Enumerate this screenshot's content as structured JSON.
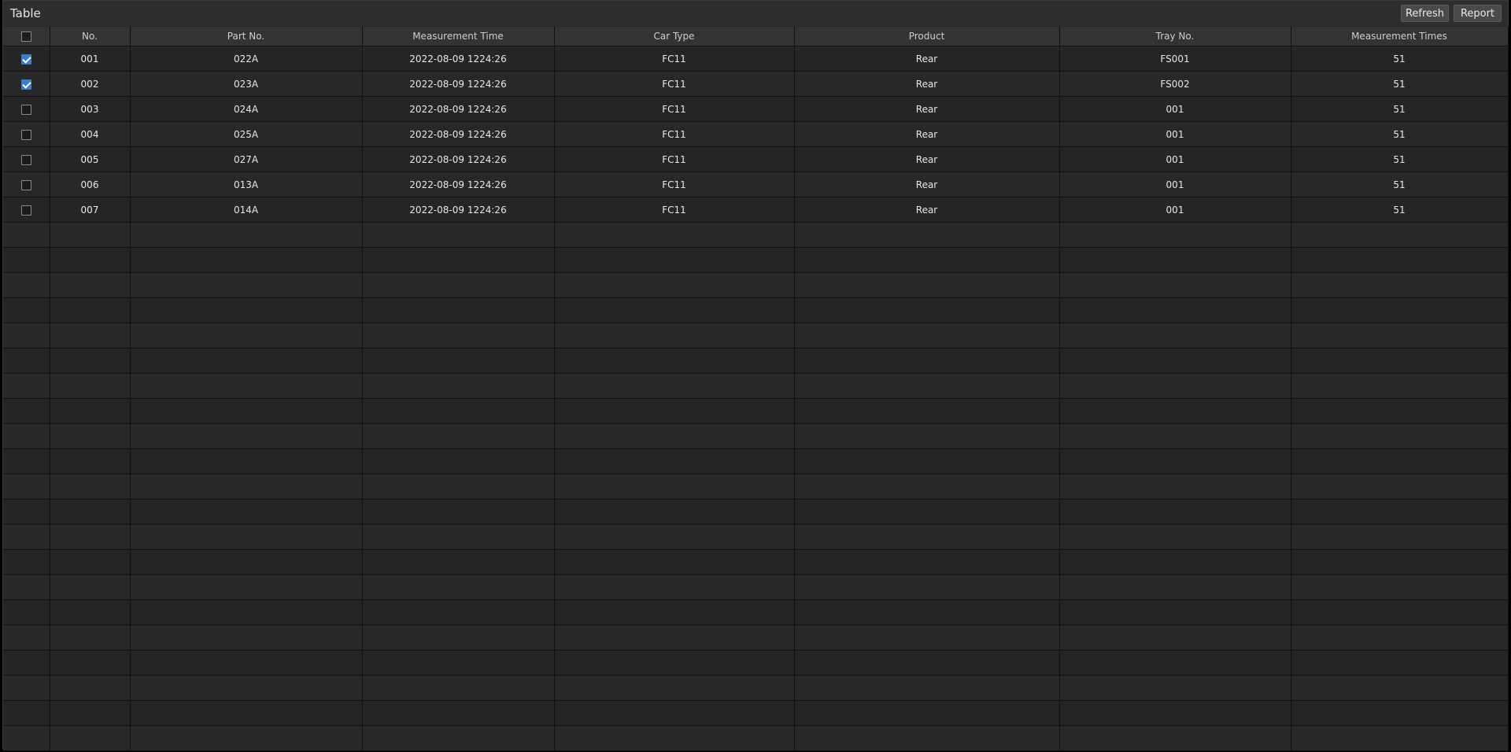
{
  "header": {
    "title": "Table",
    "refresh_label": "Refresh",
    "report_label": "Report"
  },
  "table": {
    "columns": [
      "No.",
      "Part No.",
      "Measurement Time",
      "Car Type",
      "Product",
      "Tray No.",
      "Measurement Times"
    ],
    "select_all_checked": false,
    "rows": [
      {
        "checked": true,
        "no": "001",
        "part_no": "022A",
        "measurement_time": "2022-08-09 1224:26",
        "car_type": "FC11",
        "product": "Rear",
        "tray_no": "FS001",
        "measurement_times": "51"
      },
      {
        "checked": true,
        "no": "002",
        "part_no": "023A",
        "measurement_time": "2022-08-09 1224:26",
        "car_type": "FC11",
        "product": "Rear",
        "tray_no": "FS002",
        "measurement_times": "51"
      },
      {
        "checked": false,
        "no": "003",
        "part_no": "024A",
        "measurement_time": "2022-08-09 1224:26",
        "car_type": "FC11",
        "product": "Rear",
        "tray_no": "001",
        "measurement_times": "51"
      },
      {
        "checked": false,
        "no": "004",
        "part_no": "025A",
        "measurement_time": "2022-08-09 1224:26",
        "car_type": "FC11",
        "product": "Rear",
        "tray_no": "001",
        "measurement_times": "51"
      },
      {
        "checked": false,
        "no": "005",
        "part_no": "027A",
        "measurement_time": "2022-08-09 1224:26",
        "car_type": "FC11",
        "product": "Rear",
        "tray_no": "001",
        "measurement_times": "51"
      },
      {
        "checked": false,
        "no": "006",
        "part_no": "013A",
        "measurement_time": "2022-08-09 1224:26",
        "car_type": "FC11",
        "product": "Rear",
        "tray_no": "001",
        "measurement_times": "51"
      },
      {
        "checked": false,
        "no": "007",
        "part_no": "014A",
        "measurement_time": "2022-08-09 1224:26",
        "car_type": "FC11",
        "product": "Rear",
        "tray_no": "001",
        "measurement_times": "51"
      }
    ]
  },
  "colors": {
    "background": "#262626",
    "header_background": "#333333",
    "text": "#e8e8e8",
    "checkbox_accent": "#2f7fe0"
  }
}
